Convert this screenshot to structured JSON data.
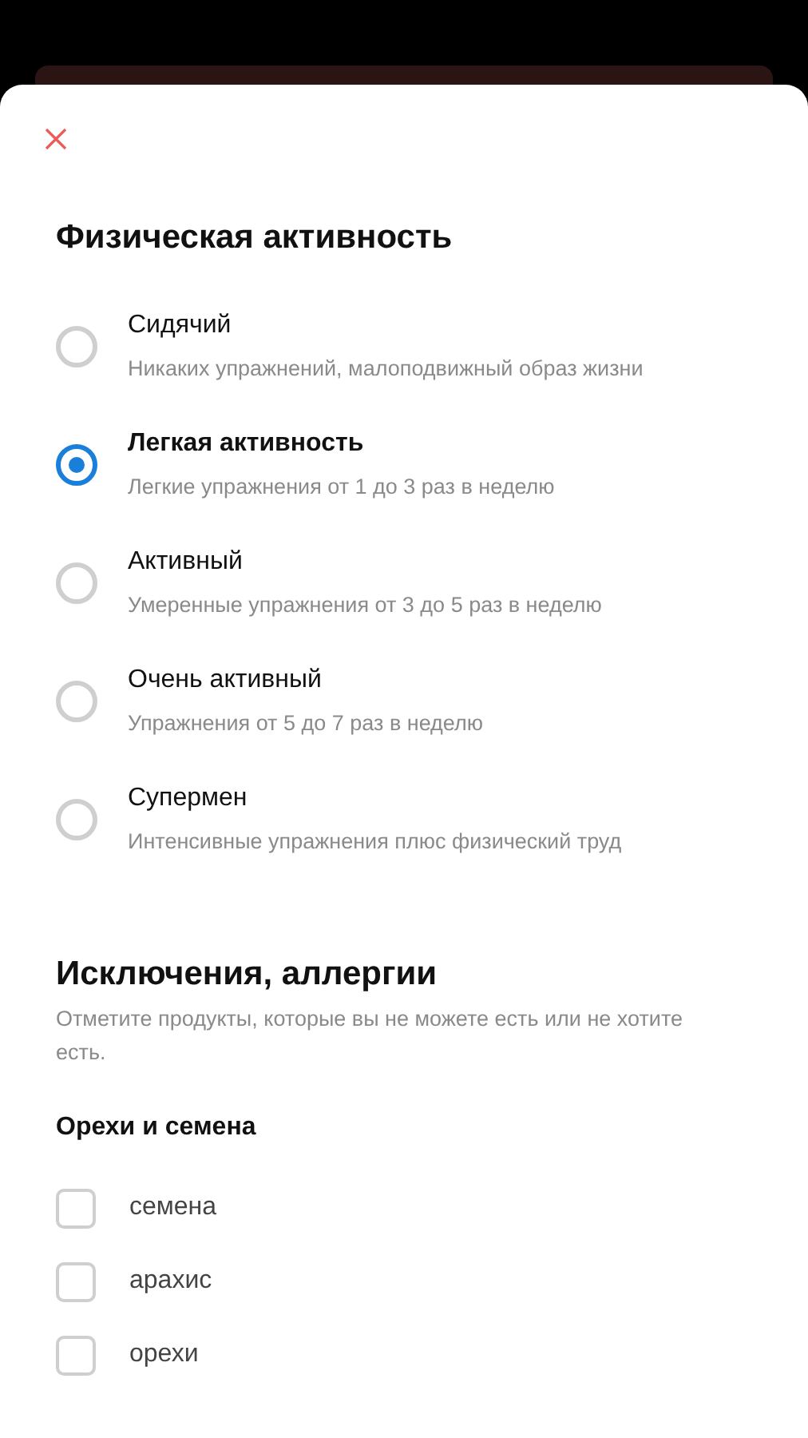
{
  "activity": {
    "title": "Физическая активность",
    "options": [
      {
        "label": "Сидячий",
        "description": "Никаких упражнений, малоподвижный образ жизни",
        "selected": false
      },
      {
        "label": "Легкая активность",
        "description": "Легкие упражнения от 1 до 3 раз в неделю",
        "selected": true
      },
      {
        "label": "Активный",
        "description": "Умеренные упражнения от 3 до 5 раз в неделю",
        "selected": false
      },
      {
        "label": "Очень активный",
        "description": "Упражнения от 5 до 7 раз в неделю",
        "selected": false
      },
      {
        "label": "Супермен",
        "description": "Интенсивные упражнения плюс физический труд",
        "selected": false
      }
    ]
  },
  "exclusions": {
    "title": "Исключения, аллергии",
    "description": "Отметите продукты, которые вы не можете есть или не хотите есть.",
    "groups": [
      {
        "title": "Орехи и семена",
        "items": [
          {
            "label": "семена",
            "checked": false
          },
          {
            "label": "арахис",
            "checked": false
          },
          {
            "label": "орехи",
            "checked": false
          }
        ]
      }
    ]
  }
}
